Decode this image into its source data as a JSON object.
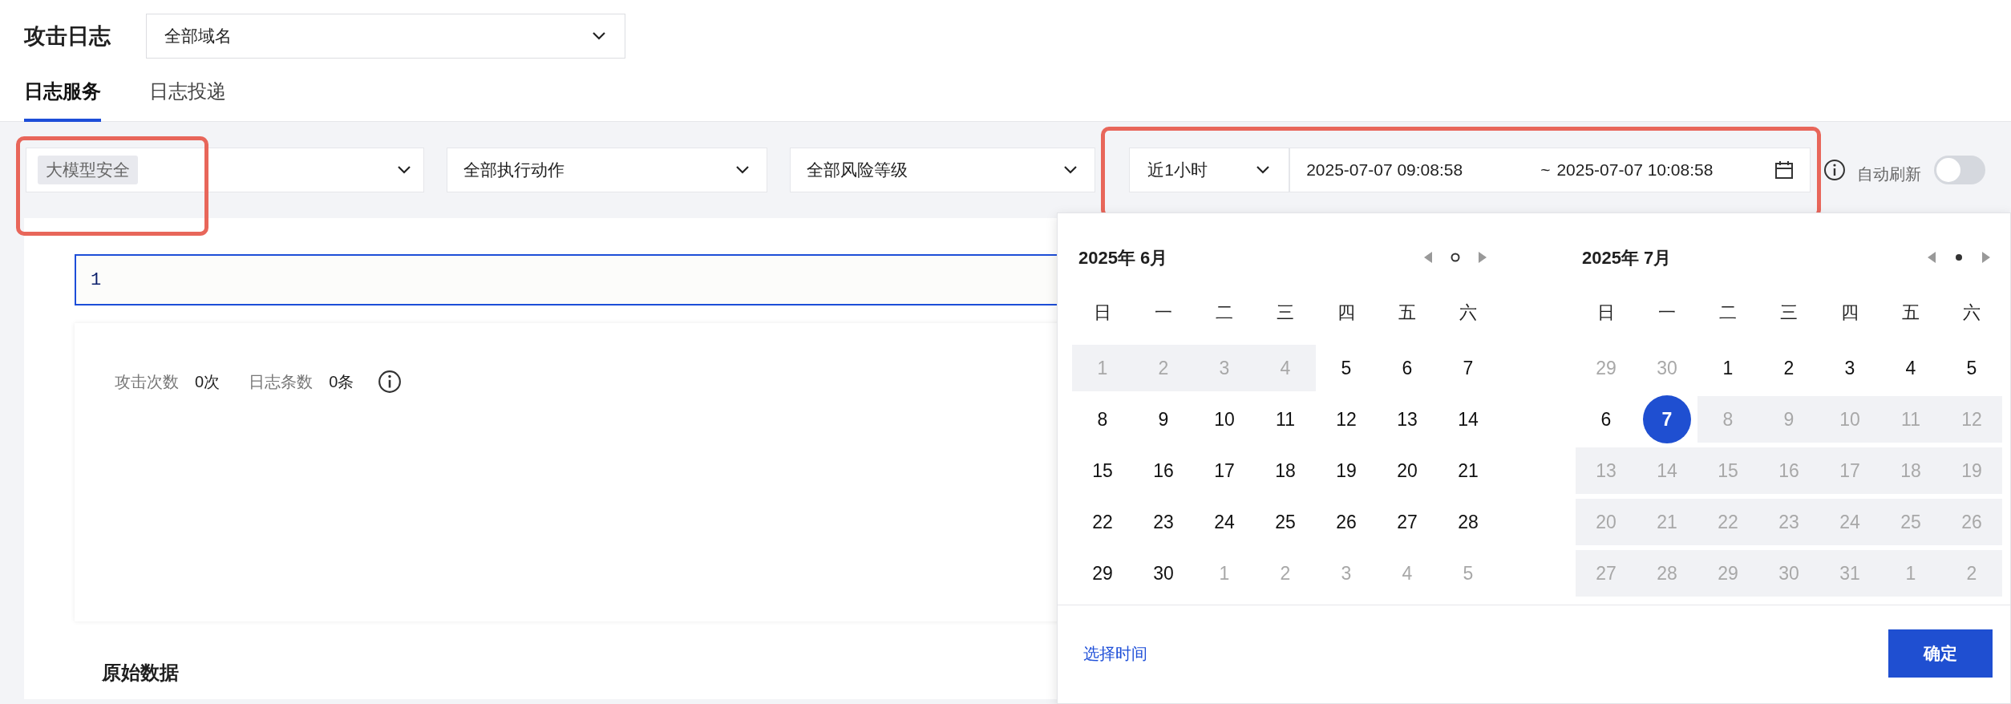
{
  "page": {
    "title": "攻击日志",
    "domain_select": "全部域名"
  },
  "tabs": [
    {
      "label": "日志服务",
      "selected": true
    },
    {
      "label": "日志投递",
      "selected": false
    }
  ],
  "filters": {
    "category_tag": "大模型安全",
    "action_select": "全部执行动作",
    "risk_select": "全部风险等级",
    "quick_range": "近1小时",
    "range_start": "2025-07-07 09:08:58",
    "range_separator": "~",
    "range_end": "2025-07-07 10:08:58",
    "auto_refresh": {
      "label": "自动刷新",
      "on": false
    }
  },
  "annotations": [
    {
      "kind": "highlight"
    },
    {
      "kind": "highlight"
    }
  ],
  "query": {
    "value": "1"
  },
  "stats": [
    {
      "label": "攻击次数",
      "value": "0次"
    },
    {
      "label": "日志条数",
      "value": "0条"
    }
  ],
  "section_title": "原始数据",
  "calendar": {
    "months": [
      {
        "title": "2025年 6月",
        "today_marker": false,
        "weekdays": [
          "日",
          "一",
          "二",
          "三",
          "四",
          "五",
          "六"
        ],
        "days": [
          {
            "text": "1",
            "kind": "disabled",
            "selected": false
          },
          {
            "text": "2",
            "kind": "disabled",
            "selected": false
          },
          {
            "text": "3",
            "kind": "disabled",
            "selected": false
          },
          {
            "text": "4",
            "kind": "disabled",
            "selected": false
          },
          {
            "text": "5",
            "kind": "day",
            "selected": false
          },
          {
            "text": "6",
            "kind": "day",
            "selected": false
          },
          {
            "text": "7",
            "kind": "day",
            "selected": false
          },
          {
            "text": "8",
            "kind": "day",
            "selected": false
          },
          {
            "text": "9",
            "kind": "day",
            "selected": false
          },
          {
            "text": "10",
            "kind": "day",
            "selected": false
          },
          {
            "text": "11",
            "kind": "day",
            "selected": false
          },
          {
            "text": "12",
            "kind": "day",
            "selected": false
          },
          {
            "text": "13",
            "kind": "day",
            "selected": false
          },
          {
            "text": "14",
            "kind": "day",
            "selected": false
          },
          {
            "text": "15",
            "kind": "day",
            "selected": false
          },
          {
            "text": "16",
            "kind": "day",
            "selected": false
          },
          {
            "text": "17",
            "kind": "day",
            "selected": false
          },
          {
            "text": "18",
            "kind": "day",
            "selected": false
          },
          {
            "text": "19",
            "kind": "day",
            "selected": false
          },
          {
            "text": "20",
            "kind": "day",
            "selected": false
          },
          {
            "text": "21",
            "kind": "day",
            "selected": false
          },
          {
            "text": "22",
            "kind": "day",
            "selected": false
          },
          {
            "text": "23",
            "kind": "day",
            "selected": false
          },
          {
            "text": "24",
            "kind": "day",
            "selected": false
          },
          {
            "text": "25",
            "kind": "day",
            "selected": false
          },
          {
            "text": "26",
            "kind": "day",
            "selected": false
          },
          {
            "text": "27",
            "kind": "day",
            "selected": false
          },
          {
            "text": "28",
            "kind": "day",
            "selected": false
          },
          {
            "text": "29",
            "kind": "day",
            "selected": false
          },
          {
            "text": "30",
            "kind": "day",
            "selected": false
          },
          {
            "text": "1",
            "kind": "outside",
            "selected": false
          },
          {
            "text": "2",
            "kind": "outside",
            "selected": false
          },
          {
            "text": "3",
            "kind": "outside",
            "selected": false
          },
          {
            "text": "4",
            "kind": "outside",
            "selected": false
          },
          {
            "text": "5",
            "kind": "outside",
            "selected": false
          }
        ]
      },
      {
        "title": "2025年 7月",
        "today_marker": true,
        "weekdays": [
          "日",
          "一",
          "二",
          "三",
          "四",
          "五",
          "六"
        ],
        "days": [
          {
            "text": "29",
            "kind": "outside",
            "selected": false
          },
          {
            "text": "30",
            "kind": "outside",
            "selected": false
          },
          {
            "text": "1",
            "kind": "day",
            "selected": false
          },
          {
            "text": "2",
            "kind": "day",
            "selected": false
          },
          {
            "text": "3",
            "kind": "day",
            "selected": false
          },
          {
            "text": "4",
            "kind": "day",
            "selected": false
          },
          {
            "text": "5",
            "kind": "day",
            "selected": false
          },
          {
            "text": "6",
            "kind": "day",
            "selected": false
          },
          {
            "text": "7",
            "kind": "day",
            "selected": true
          },
          {
            "text": "8",
            "kind": "disabled",
            "selected": false
          },
          {
            "text": "9",
            "kind": "disabled",
            "selected": false
          },
          {
            "text": "10",
            "kind": "disabled",
            "selected": false
          },
          {
            "text": "11",
            "kind": "disabled",
            "selected": false
          },
          {
            "text": "12",
            "kind": "disabled",
            "selected": false
          },
          {
            "text": "13",
            "kind": "disabled",
            "selected": false
          },
          {
            "text": "14",
            "kind": "disabled",
            "selected": false
          },
          {
            "text": "15",
            "kind": "disabled",
            "selected": false
          },
          {
            "text": "16",
            "kind": "disabled",
            "selected": false
          },
          {
            "text": "17",
            "kind": "disabled",
            "selected": false
          },
          {
            "text": "18",
            "kind": "disabled",
            "selected": false
          },
          {
            "text": "19",
            "kind": "disabled",
            "selected": false
          },
          {
            "text": "20",
            "kind": "disabled",
            "selected": false
          },
          {
            "text": "21",
            "kind": "disabled",
            "selected": false
          },
          {
            "text": "22",
            "kind": "disabled",
            "selected": false
          },
          {
            "text": "23",
            "kind": "disabled",
            "selected": false
          },
          {
            "text": "24",
            "kind": "disabled",
            "selected": false
          },
          {
            "text": "25",
            "kind": "disabled",
            "selected": false
          },
          {
            "text": "26",
            "kind": "disabled",
            "selected": false
          },
          {
            "text": "27",
            "kind": "disabled",
            "selected": false
          },
          {
            "text": "28",
            "kind": "disabled",
            "selected": false
          },
          {
            "text": "29",
            "kind": "disabled",
            "selected": false
          },
          {
            "text": "30",
            "kind": "disabled",
            "selected": false
          },
          {
            "text": "31",
            "kind": "disabled",
            "selected": false
          },
          {
            "text": "1",
            "kind": "disabled",
            "selected": false
          },
          {
            "text": "2",
            "kind": "disabled",
            "selected": false
          }
        ]
      }
    ],
    "footer_link": "选择时间",
    "confirm_button": "确定"
  }
}
